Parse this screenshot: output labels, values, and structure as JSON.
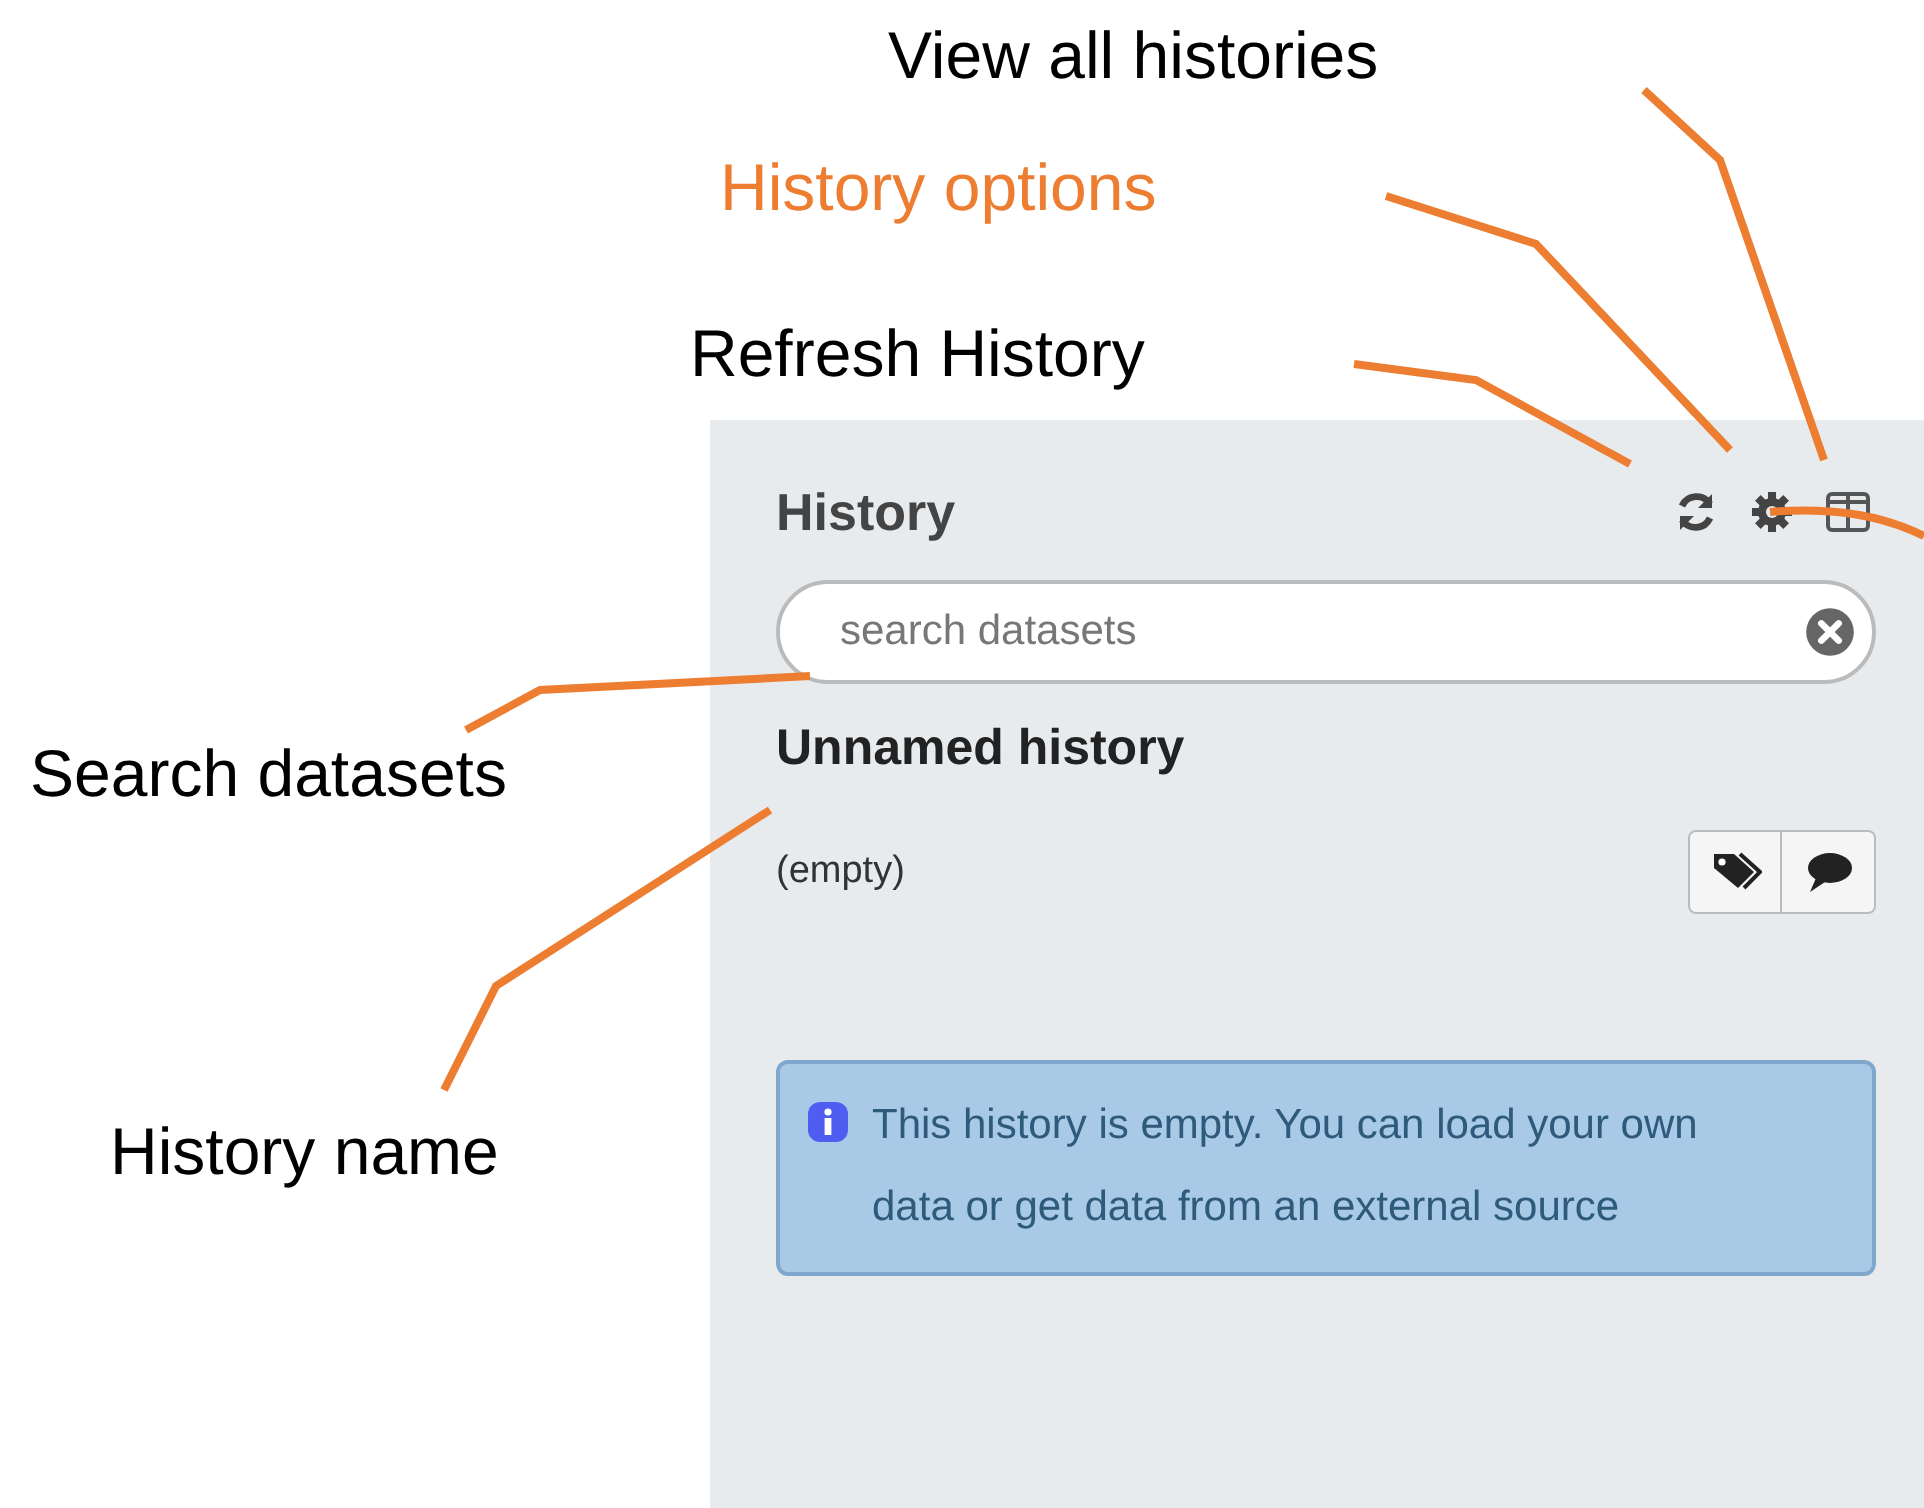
{
  "annotations": [
    {
      "text": "View all histories",
      "color": "#000000"
    },
    {
      "text": "History options",
      "color": "#ed7d31"
    },
    {
      "text": "Refresh History",
      "color": "#000000"
    },
    {
      "text": "Search datasets",
      "color": "#000000"
    },
    {
      "text": "History name",
      "color": "#000000"
    }
  ],
  "panel": {
    "title": "History",
    "search": {
      "placeholder": "search datasets"
    },
    "history_name": "Unnamed history",
    "size": "(empty)",
    "message": "This history is empty. You can load your own data or get data from an external source"
  }
}
